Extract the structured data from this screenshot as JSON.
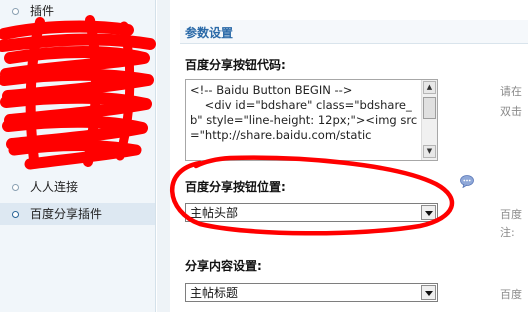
{
  "sidebar": {
    "items": [
      {
        "label": "插件",
        "active": false
      },
      {
        "label": "人人连接",
        "active": false
      },
      {
        "label": "百度分享插件",
        "active": true
      }
    ]
  },
  "main": {
    "section_title": "参数设置",
    "code_field": {
      "label": "百度分享按钮代码:",
      "value": "<!-- Baidu Button BEGIN -->\n    <div id=\"bdshare\" class=\"bdshare_b\" style=\"line-height: 12px;\"><img src=\"http://share.baidu.com/static",
      "tip_lines": [
        "请在",
        "双击"
      ]
    },
    "position_field": {
      "label": "百度分享按钮位置:",
      "help_icon": "speech-bubble-help-icon",
      "selected": "主帖头部",
      "tip_lines": [
        "百度",
        "注:"
      ]
    },
    "content_field": {
      "label": "分享内容设置:",
      "selected": "主帖标题",
      "tip_lines": [
        "百度"
      ]
    }
  },
  "annotation": {
    "ink_color": "#ff0000"
  }
}
